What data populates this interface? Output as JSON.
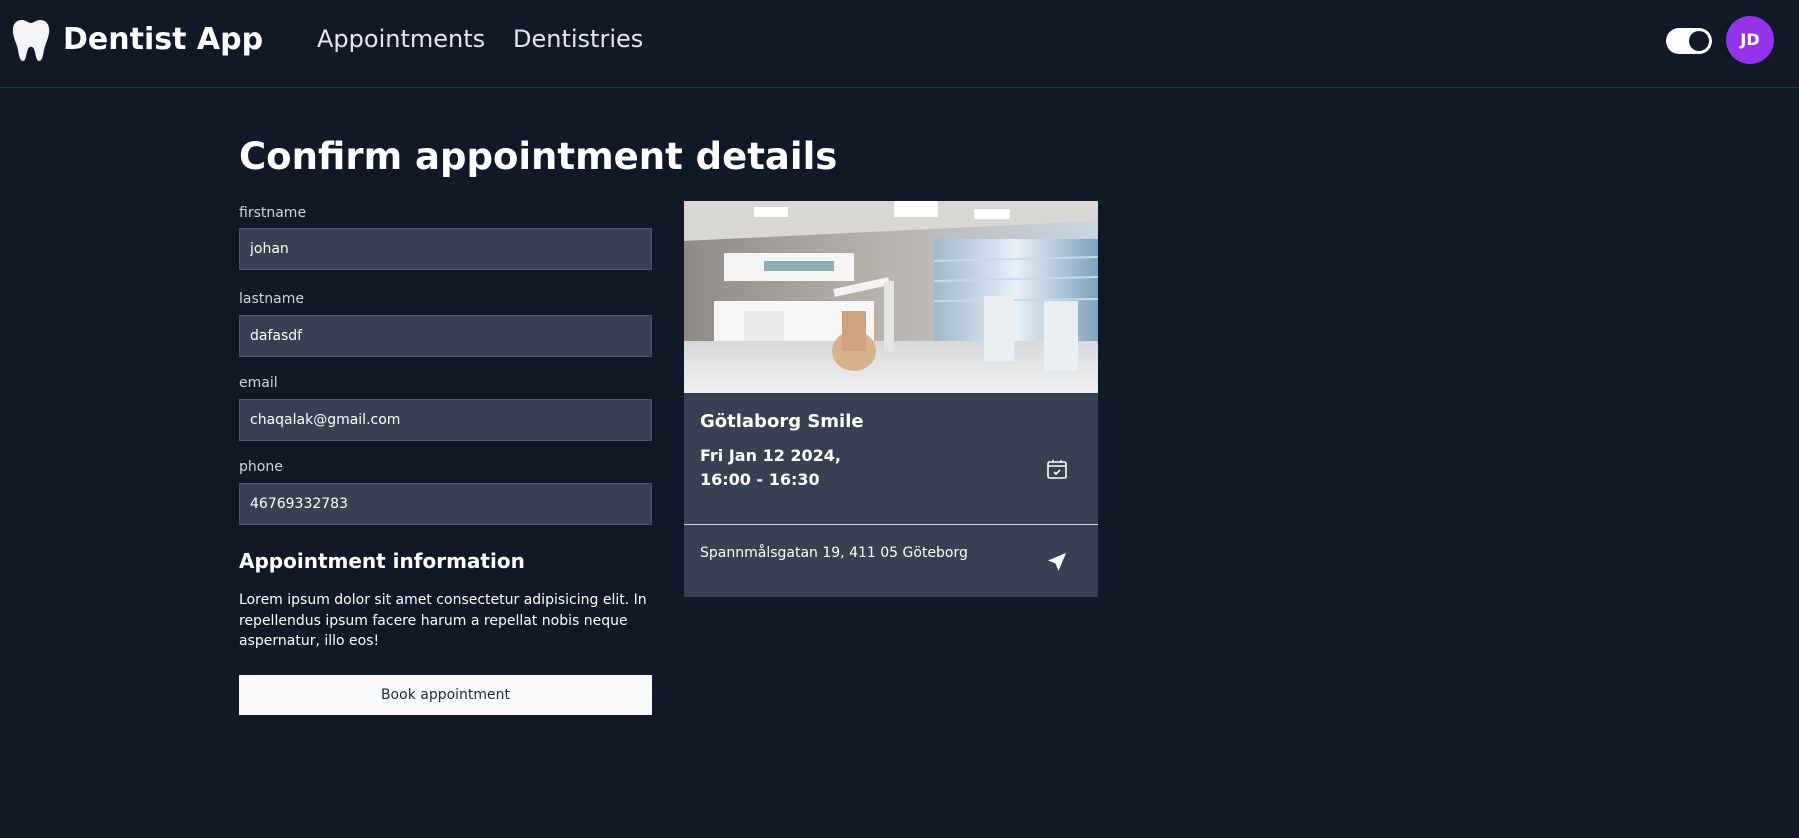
{
  "header": {
    "app_title": "Dentist App",
    "logo_icon": "tooth-icon",
    "nav": [
      {
        "label": "Appointments"
      },
      {
        "label": "Dentistries"
      }
    ],
    "theme_toggle_on": true,
    "avatar_initials": "JD",
    "avatar_color": "#9333ea"
  },
  "page": {
    "title": "Confirm appointment details"
  },
  "form": {
    "fields": [
      {
        "label": "firstname",
        "value": "johan"
      },
      {
        "label": "lastname",
        "value": "dafasdf"
      },
      {
        "label": "email",
        "value": "chaqalak@gmail.com"
      },
      {
        "label": "phone",
        "value": "46769332783"
      }
    ],
    "info_title": "Appointment information",
    "info_text": "Lorem ipsum dolor sit amet consectetur adipisicing elit. In repellendus ipsum facere harum a repellat nobis neque aspernatur, illo eos!",
    "submit_label": "Book appointment"
  },
  "card": {
    "image": "dental-clinic-photo",
    "clinic_name": "Götlaborg Smile",
    "date_line": "Fri Jan 12 2024,",
    "time_line": "16:00 - 16:30",
    "date_icon": "calendar-check-icon",
    "address": "Spannmålsgatan 19, 411 05 Göteborg",
    "address_icon": "navigation-arrow-icon"
  },
  "colors": {
    "background": "#111827",
    "panel": "#374151",
    "accent": "#9333ea"
  }
}
